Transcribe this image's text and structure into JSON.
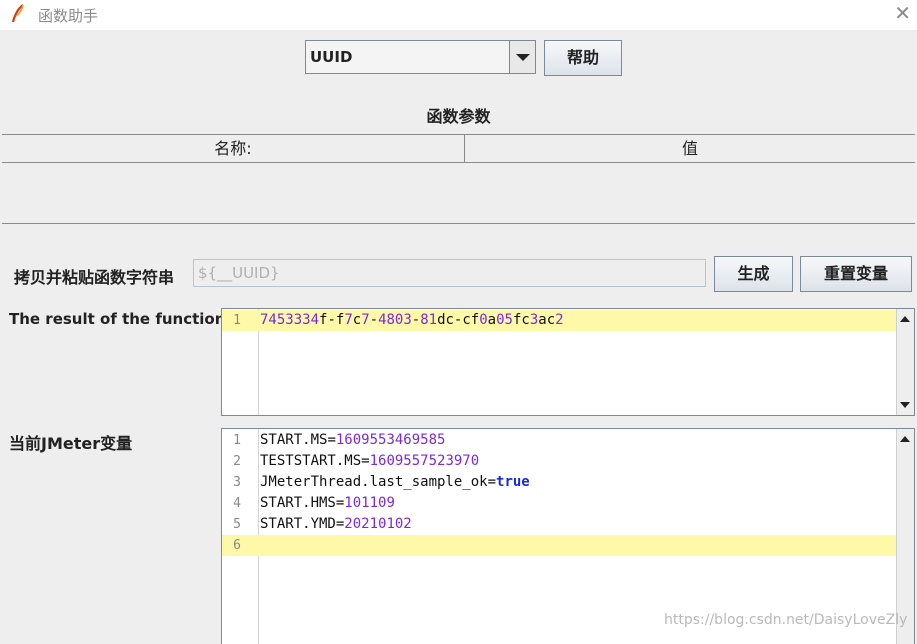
{
  "window": {
    "title": "函数助手",
    "icon": "feather-icon",
    "close_glyph": "✕"
  },
  "function_select": {
    "selected": "UUID"
  },
  "buttons": {
    "help": "帮助",
    "generate": "生成",
    "reset": "重置变量"
  },
  "params": {
    "section_title": "函数参数",
    "columns": [
      "名称:",
      "值"
    ]
  },
  "copy_paste": {
    "label": "拷贝并粘贴函数字符串",
    "value": "${__UUID}"
  },
  "result": {
    "label": "The result of the function is",
    "lines": [
      {
        "num": "1",
        "text": "7453334f-f7c7-4803-81dc-cf0a05fc3ac2"
      }
    ]
  },
  "jmeter_vars": {
    "label": "当前JMeter变量",
    "lines": [
      {
        "num": "1",
        "key": "START.MS",
        "value": "1609553469585"
      },
      {
        "num": "2",
        "key": "TESTSTART.MS",
        "value": "1609557523970"
      },
      {
        "num": "3",
        "key": "JMeterThread.last_sample_ok",
        "value": "true"
      },
      {
        "num": "4",
        "key": "START.HMS",
        "value": "101109"
      },
      {
        "num": "5",
        "key": "START.YMD",
        "value": "20210102"
      },
      {
        "num": "6",
        "key": "",
        "value": ""
      }
    ]
  },
  "watermark": "https://blog.csdn.net/DaisyLoveZly",
  "colors": {
    "highlight_line": "#fdf9a8",
    "number_literal": "#7d2ad8",
    "boolean_literal": "#1a2bd6"
  }
}
